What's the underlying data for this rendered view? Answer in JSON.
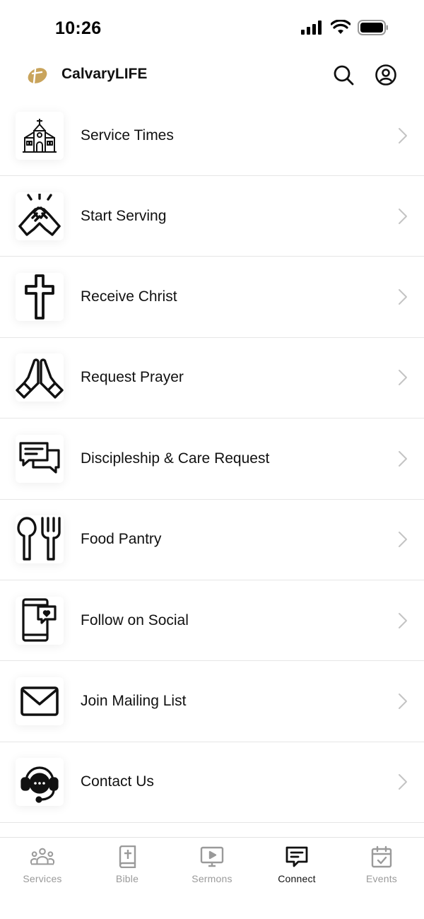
{
  "status_bar": {
    "time": "10:26"
  },
  "header": {
    "title": "CalvaryLIFE",
    "logo_color": "#c9a45c"
  },
  "menu": {
    "items": [
      {
        "label": "Service Times",
        "icon": "church-icon"
      },
      {
        "label": "Start Serving",
        "icon": "clasped-hands-icon"
      },
      {
        "label": "Receive Christ",
        "icon": "cross-icon"
      },
      {
        "label": "Request Prayer",
        "icon": "praying-hands-icon"
      },
      {
        "label": "Discipleship & Care Request",
        "icon": "chat-bubbles-icon"
      },
      {
        "label": "Food Pantry",
        "icon": "spoon-fork-icon"
      },
      {
        "label": "Follow on Social",
        "icon": "phone-heart-icon"
      },
      {
        "label": "Join Mailing List",
        "icon": "envelope-icon"
      },
      {
        "label": "Contact Us",
        "icon": "headset-chat-icon"
      }
    ]
  },
  "tabs": [
    {
      "label": "Services",
      "icon": "people-icon",
      "active": false
    },
    {
      "label": "Bible",
      "icon": "bible-icon",
      "active": false
    },
    {
      "label": "Sermons",
      "icon": "video-icon",
      "active": false
    },
    {
      "label": "Connect",
      "icon": "message-icon",
      "active": true
    },
    {
      "label": "Events",
      "icon": "calendar-check-icon",
      "active": false
    }
  ],
  "colors": {
    "accent": "#111111",
    "inactive_tab": "#9a9a9a",
    "divider": "#e6e6e6"
  }
}
